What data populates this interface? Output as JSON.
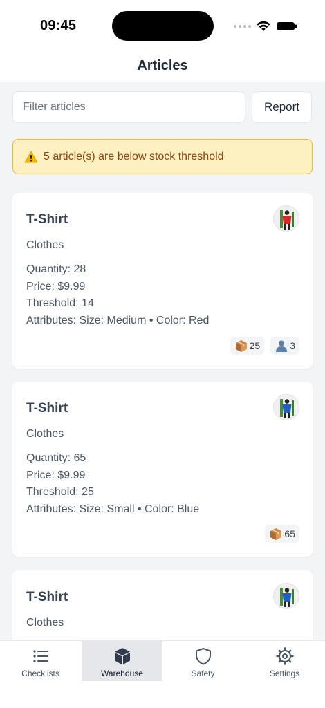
{
  "status_bar": {
    "time": "09:45"
  },
  "header": {
    "title": "Articles"
  },
  "filter": {
    "placeholder": "Filter articles",
    "report_label": "Report"
  },
  "alert": {
    "text": "5 article(s) are below stock threshold",
    "icon": "warning-icon"
  },
  "articles": [
    {
      "name": "T-Shirt",
      "category": "Clothes",
      "quantity": "Quantity: 28",
      "price": "Price: $9.99",
      "threshold": "Threshold: 14",
      "attributes": "Attributes: Size: Medium • Color: Red",
      "box_count": "25",
      "user_count": "3",
      "shirt_color": "#d62828"
    },
    {
      "name": "T-Shirt",
      "category": "Clothes",
      "quantity": "Quantity: 65",
      "price": "Price: $9.99",
      "threshold": "Threshold: 25",
      "attributes": "Attributes: Size: Small • Color: Blue",
      "box_count": "65",
      "shirt_color": "#1f5fbf"
    },
    {
      "name": "T-Shirt",
      "category": "Clothes",
      "shirt_color": "#1f5fbf"
    }
  ],
  "tabs": [
    {
      "label": "Checklists",
      "icon": "list-icon"
    },
    {
      "label": "Warehouse",
      "icon": "cube-icon",
      "active": true
    },
    {
      "label": "Safety",
      "icon": "shield-icon"
    },
    {
      "label": "Settings",
      "icon": "gear-icon"
    }
  ],
  "colors": {
    "alert_bg": "#fdf1c2",
    "alert_border": "#f1b83c",
    "alert_text": "#92400e",
    "active_tab_bg": "#e5e7eb"
  }
}
